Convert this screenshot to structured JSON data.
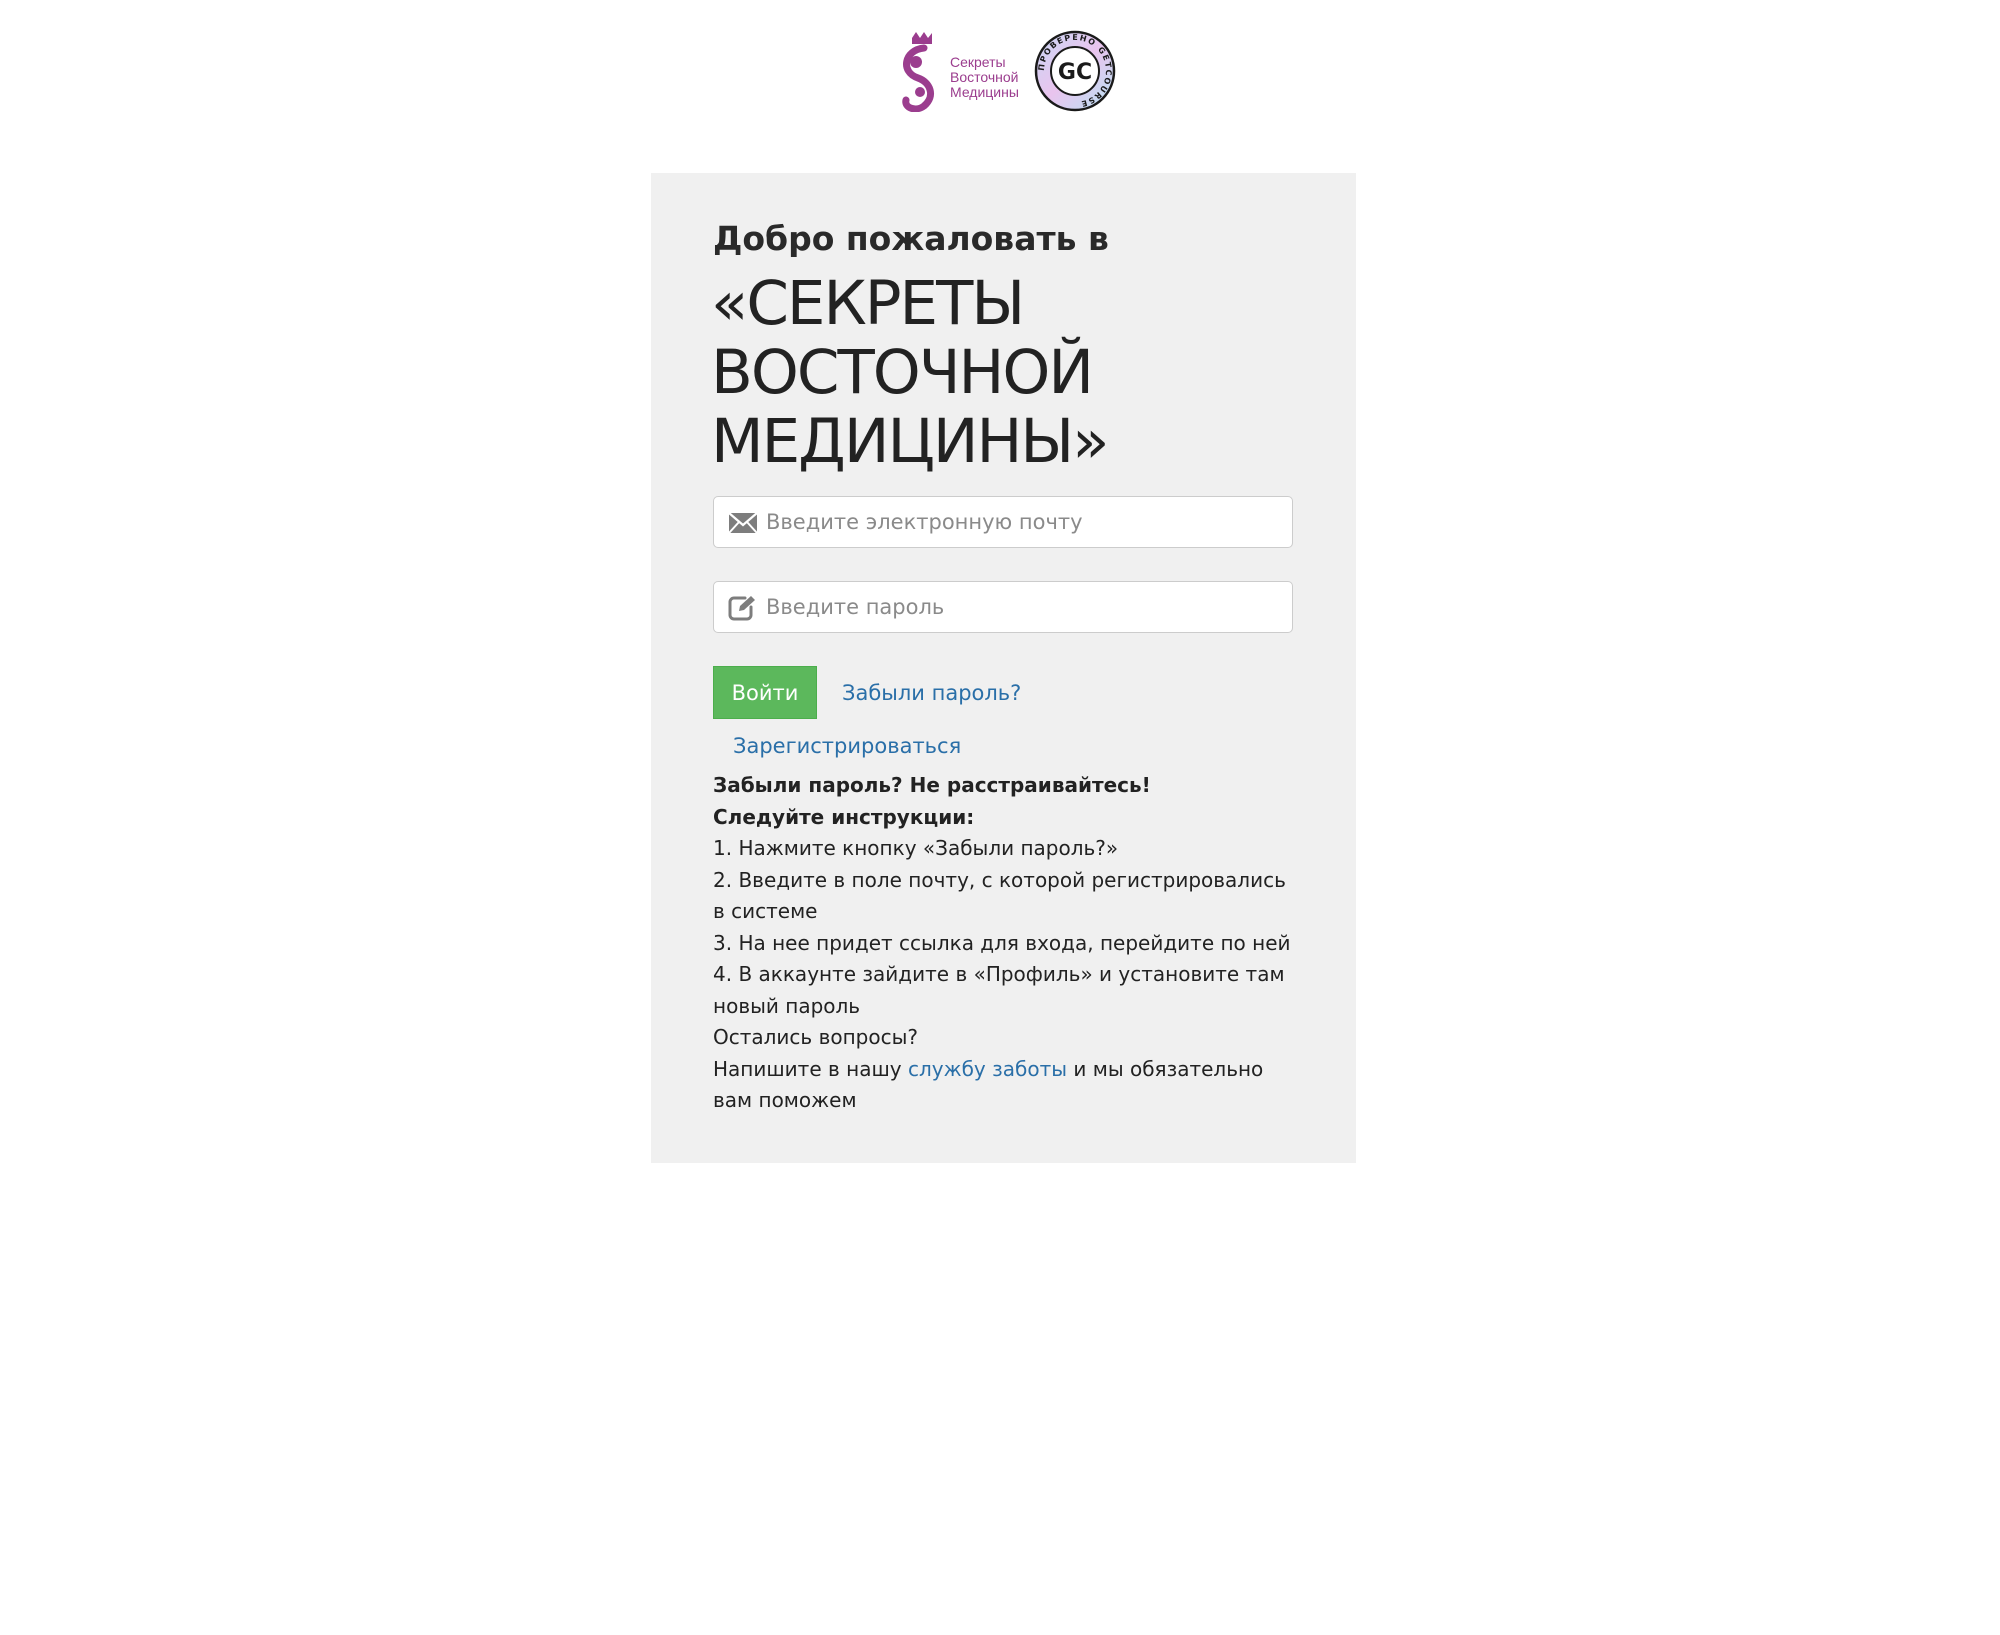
{
  "header": {
    "brand_lines": [
      "Секреты",
      "Восточной",
      "Медицины"
    ],
    "badge_ring_text": "ПРОВЕРЕНО GETCOURSE",
    "badge_monogram": "GC",
    "brand_color": "#9b3d8e"
  },
  "login": {
    "welcome": "Добро пожаловать в",
    "school_name": "«СЕКРЕТЫ ВОСТОЧНОЙ МЕДИЦИНЫ»",
    "email_placeholder": "Введите электронную почту",
    "password_placeholder": "Введите пароль",
    "login_button": "Войти",
    "forgot_link": "Забыли пароль?",
    "register_link": "Зарегистрироваться",
    "email_icon": "envelope-icon",
    "password_icon": "edit-icon",
    "button_color": "#5cb85c",
    "link_color": "#2a6fa8"
  },
  "help": {
    "heading1": "Забыли пароль? Не расстраивайтесь!",
    "heading2": "Следуйте инструкции:",
    "step1": "1. Нажмите кнопку «Забыли пароль?»",
    "step2": "2. Введите в поле почту, с которой регистрировались в системе",
    "step3": "3. На нее придет ссылка для входа, перейдите по ней",
    "step4": "4. В аккаунте зайдите в «Профиль» и установите там новый пароль",
    "questions": "Остались вопросы?",
    "contact_before": "Напишите в нашу ",
    "contact_link": "службу заботы",
    "contact_after": " и мы обязательно вам поможем"
  }
}
